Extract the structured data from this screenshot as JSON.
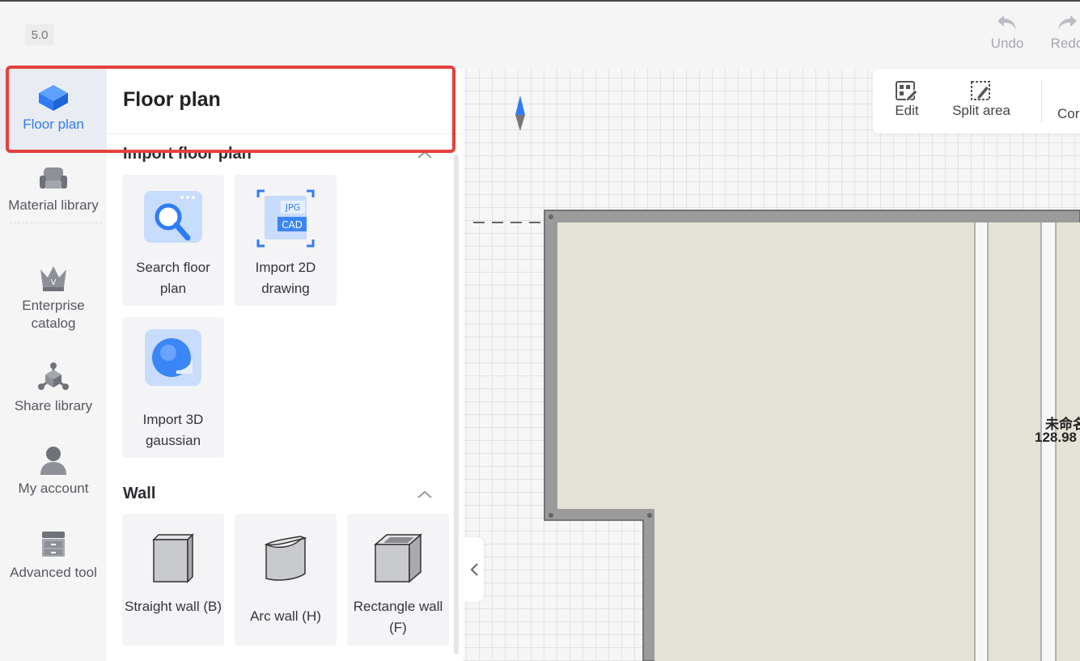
{
  "app": {
    "version": "5.0"
  },
  "history": {
    "undo_label": "Undo",
    "redo_label": "Redo"
  },
  "toolbar": {
    "edit_label": "Edit",
    "split_label": "Split area",
    "next_label": "Cor"
  },
  "rail": {
    "items": [
      {
        "label": "Floor plan",
        "icon": "floor-plan-icon",
        "active": true
      },
      {
        "label": "Material library",
        "icon": "sofa-icon"
      },
      {
        "label": "Enterprise catalog",
        "icon": "crown-icon"
      },
      {
        "label": "Share library",
        "icon": "share-nodes-icon"
      },
      {
        "label": "My account",
        "icon": "user-icon"
      },
      {
        "label": "Advanced tool",
        "icon": "cabinet-icon"
      }
    ]
  },
  "panel": {
    "title": "Floor plan",
    "sections": {
      "import": {
        "title": "Import floor plan",
        "cards": [
          {
            "label": "Search floor plan",
            "icon": "search-floor-plan-icon"
          },
          {
            "label": "Import 2D drawing",
            "icon": "jpg-cad-icon",
            "badge_top": "JPG",
            "badge_bottom": "CAD"
          },
          {
            "label": "Import 3D gaussian",
            "icon": "globe-3d-icon"
          }
        ]
      },
      "wall": {
        "title": "Wall",
        "cards": [
          {
            "label": "Straight wall (B)",
            "icon": "straight-wall-icon"
          },
          {
            "label": "Arc wall (H)",
            "icon": "arc-wall-icon"
          },
          {
            "label": "Rectangle wall (F)",
            "icon": "rectangle-wall-icon"
          }
        ]
      }
    }
  },
  "canvas": {
    "room_name": "未命名",
    "room_area": "128.98"
  },
  "colors": {
    "accent": "#2e7cf6",
    "highlight": "#e5413c",
    "wall": "#9b9b9b",
    "floor": "#e4e1d6"
  }
}
